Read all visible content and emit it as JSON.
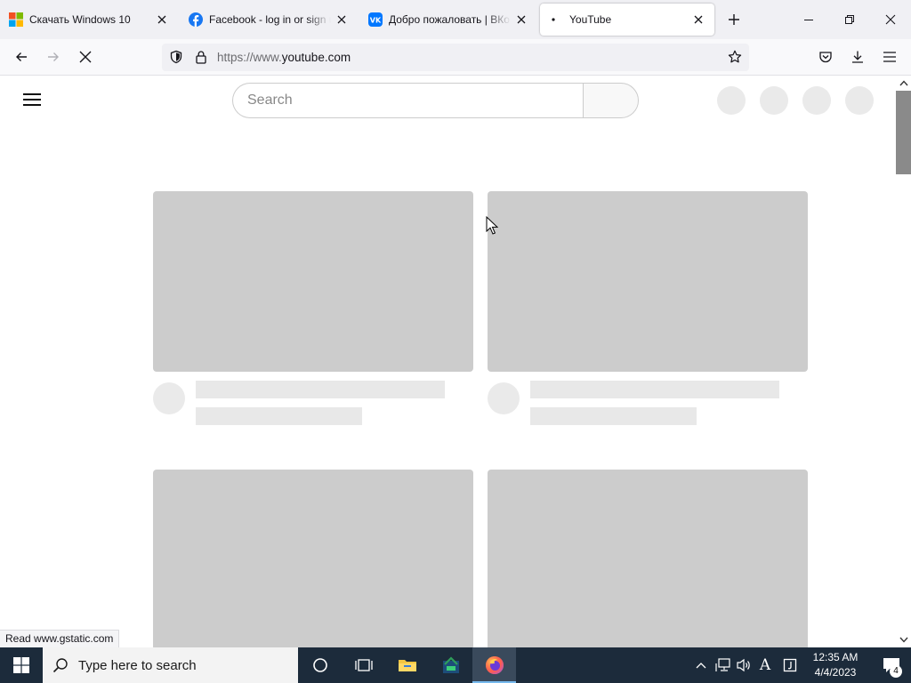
{
  "browser": {
    "tabs": [
      {
        "title": "Скачать Windows 10",
        "favicon": "windows-logo-icon",
        "active": false
      },
      {
        "title": "Facebook - log in or sign up",
        "favicon": "facebook-icon",
        "active": false
      },
      {
        "title": "Добро пожаловать | ВКонтакте",
        "favicon": "vk-icon",
        "active": false
      },
      {
        "title": "YouTube",
        "favicon": "loading-dot-icon",
        "active": true
      }
    ],
    "url": {
      "prefix": "https://www.",
      "domain": "youtube.com"
    },
    "status_text": "Read www.gstatic.com"
  },
  "youtube": {
    "search_placeholder": "Search"
  },
  "taskbar": {
    "search_placeholder": "Type here to search",
    "time": "12:35 AM",
    "date": "4/4/2023",
    "notification_count": "4",
    "input_indicator": "A"
  },
  "colors": {
    "tab_strip": "#f0f0f4",
    "skeleton_thumb": "#cccccc",
    "skeleton_text": "#e8e8e8",
    "taskbar": "#1c2b3b",
    "facebook": "#1877f2",
    "vk": "#0077ff"
  }
}
